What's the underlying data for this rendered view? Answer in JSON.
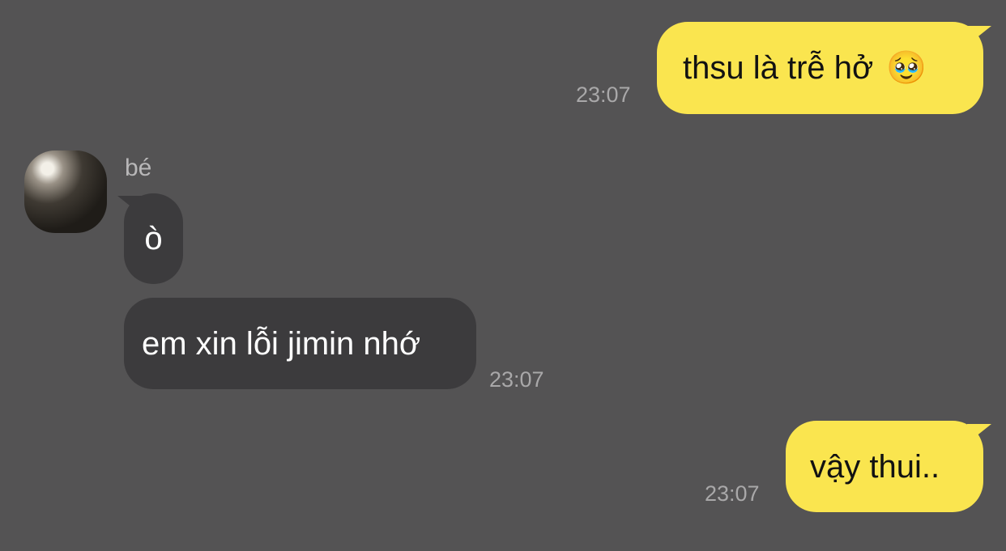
{
  "conversation": {
    "messages": [
      {
        "direction": "outgoing",
        "text": "thsu là trễ hở",
        "emoji": "🥹",
        "time": "23:07"
      },
      {
        "direction": "incoming",
        "sender": "bé",
        "text": "ò",
        "time": ""
      },
      {
        "direction": "incoming",
        "text": "em xin lỗi jimin nhớ",
        "time": "23:07"
      },
      {
        "direction": "outgoing",
        "text": "vậy thui..",
        "time": "23:07"
      }
    ]
  },
  "contact": {
    "name": "bé",
    "avatar": "profile-photo"
  },
  "colors": {
    "background": "#545354",
    "outgoing_bubble": "#fae54f",
    "incoming_bubble": "#3c3b3d",
    "timestamp": "#a9a8a9"
  }
}
